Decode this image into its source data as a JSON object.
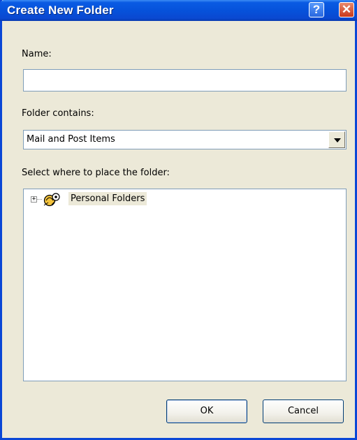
{
  "window": {
    "title": "Create New Folder",
    "help_glyph": "?",
    "close_glyph": "✕"
  },
  "form": {
    "name_label": "Name:",
    "name_value": "",
    "contains_label": "Folder contains:",
    "contains_selected": "Mail and Post Items",
    "location_label": "Select where to place the folder:"
  },
  "tree": {
    "items": [
      {
        "label": "Personal Folders",
        "expander": "+",
        "icon": "personal-folders-icon"
      }
    ]
  },
  "buttons": {
    "ok": "OK",
    "cancel": "Cancel"
  },
  "colors": {
    "titlebar": "#0652db",
    "window_bg": "#ece9d8",
    "close_button": "#c9381a"
  }
}
